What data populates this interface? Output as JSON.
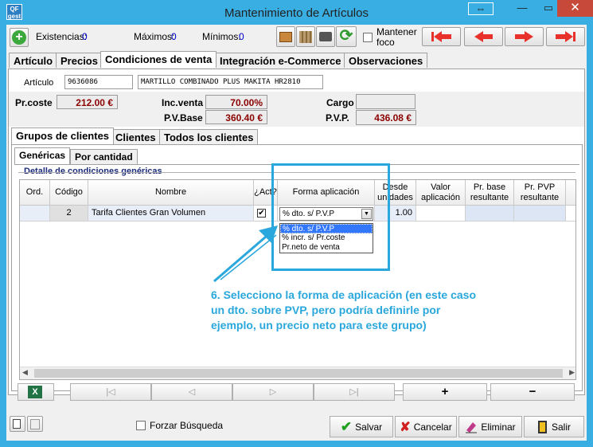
{
  "window": {
    "title": "Mantenimiento de Artículos",
    "icon_text": "QF gest",
    "restore_glyph": "⇔",
    "minimize_glyph": "—",
    "maximize_glyph": "▭",
    "close_glyph": "✕"
  },
  "toolbar": {
    "existencias_label": "Existencias:",
    "existencias_value": "0",
    "maximos_label": "Máximos:",
    "maximos_value": "0",
    "minimos_label": "Mínimos:",
    "minimos_value": "0",
    "mantener_foco_label": "Mantener foco",
    "add_glyph": "+",
    "refresh_glyph": "⟳"
  },
  "main_tabs": [
    {
      "label": "Artículo"
    },
    {
      "label": "Precios"
    },
    {
      "label": "Condiciones de venta"
    },
    {
      "label": "Integración e-Commerce"
    },
    {
      "label": "Observaciones"
    }
  ],
  "article": {
    "label": "Artículo",
    "code": "9636086",
    "description": "MARTILLO COMBINADO PLUS MAKITA HR2810"
  },
  "prices": {
    "prcoste_label": "Pr.coste",
    "prcoste_value": "212.00 €",
    "incventa_label": "Inc.venta",
    "incventa_value": "70.00%",
    "cargo_label": "Cargo",
    "cargo_value": "",
    "pvbase_label": "P.V.Base",
    "pvbase_value": "360.40 €",
    "pvp_label": "P.V.P.",
    "pvp_value": "436.08 €"
  },
  "sub_tabs": [
    {
      "label": "Grupos de clientes"
    },
    {
      "label": "Clientes"
    },
    {
      "label": "Todos los clientes"
    }
  ],
  "inner_tabs": [
    {
      "label": "Genéricas"
    },
    {
      "label": "Por cantidad"
    }
  ],
  "grid": {
    "group_title": "Detalle de condiciones genéricas",
    "columns": [
      "Ord.",
      "Código",
      "Nombre",
      "¿Act?",
      "Forma aplicación",
      "Desde unidades",
      "Valor aplicación",
      "Pr. base resultante",
      "Pr. PVP resultante"
    ],
    "rows": [
      {
        "ord": "",
        "codigo": "2",
        "nombre": "Tarifa Clientes Gran Volumen",
        "act": "✔",
        "forma": "% dto. s/ P.V.P",
        "desde": "1.00",
        "valor": "",
        "prbase": "",
        "prpvp": ""
      }
    ],
    "dropdown_options": [
      "% dto. s/ P.V.P",
      "% incr. s/ Pr.coste",
      "Pr.neto de venta"
    ],
    "selected_option_index": 0
  },
  "annotation": {
    "text": "6. Selecciono la forma de aplicación (en este caso un dto. sobre PVP, pero podría definirle por ejemplo, un precio neto para este grupo)",
    "color": "#2aa7dc"
  },
  "navigator": {
    "first": "|◁",
    "prev": "◁",
    "next": "▷",
    "last": "▷|",
    "add": "+",
    "remove": "−"
  },
  "footer": {
    "forzar_busqueda_label": "Forzar Búsqueda",
    "salvar_label": "Salvar",
    "cancelar_label": "Cancelar",
    "eliminar_label": "Eliminar",
    "salir_label": "Salir",
    "salvar_glyph": "✔",
    "cancelar_glyph": "✘"
  },
  "colors": {
    "title_bar": "#38aee2",
    "close_button": "#c7493a",
    "value_red": "#8b0000",
    "annotation_blue": "#2aa7dc",
    "selection_blue": "#3377ff"
  }
}
